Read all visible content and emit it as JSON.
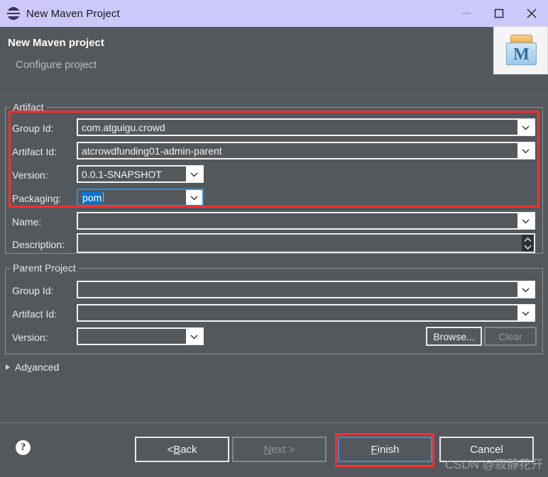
{
  "window": {
    "title": "New Maven Project",
    "icon": "eclipse-icon",
    "controls": {
      "minimize": "minimize-icon",
      "maximize": "maximize-icon",
      "close": "close-icon"
    }
  },
  "header": {
    "title": "New Maven project",
    "subtitle": "Configure project",
    "banner_icon": "maven-icon",
    "banner_letter": "M"
  },
  "artifact": {
    "legend": "Artifact",
    "group_id": {
      "label": "Group Id:",
      "value": "com.atguigu.crowd"
    },
    "artifact_id": {
      "label": "Artifact Id:",
      "value": "atcrowdfunding01-admin-parent"
    },
    "version": {
      "label": "Version:",
      "value": "0.0.1-SNAPSHOT"
    },
    "packaging": {
      "label": "Packaging:",
      "value": "pom",
      "selected": true
    },
    "name": {
      "label": "Name:",
      "value": ""
    },
    "description": {
      "label": "Description:",
      "value": ""
    }
  },
  "parent_project": {
    "legend": "Parent Project",
    "group_id": {
      "label": "Group Id:",
      "value": ""
    },
    "artifact_id": {
      "label": "Artifact Id:",
      "value": ""
    },
    "version": {
      "label": "Version:",
      "value": ""
    },
    "browse_button": "Browse...",
    "clear_button": "Clear"
  },
  "advanced": {
    "label_pre": "Ad",
    "label_mnemonic": "v",
    "label_post": "anced"
  },
  "footer": {
    "help": "?",
    "back": {
      "pre": "< ",
      "mnemonic": "B",
      "post": "ack"
    },
    "next": {
      "mnemonic": "N",
      "post": "ext >"
    },
    "finish": {
      "mnemonic": "F",
      "post": "inish"
    },
    "cancel": "Cancel"
  },
  "watermark": "CSDN @寂静花开",
  "colors": {
    "titlebar": "#ccc9fa",
    "body": "#53585c",
    "selection": "#0a74d4",
    "focus_border": "#3a8fd0",
    "annotation": "#fa2f2f"
  }
}
